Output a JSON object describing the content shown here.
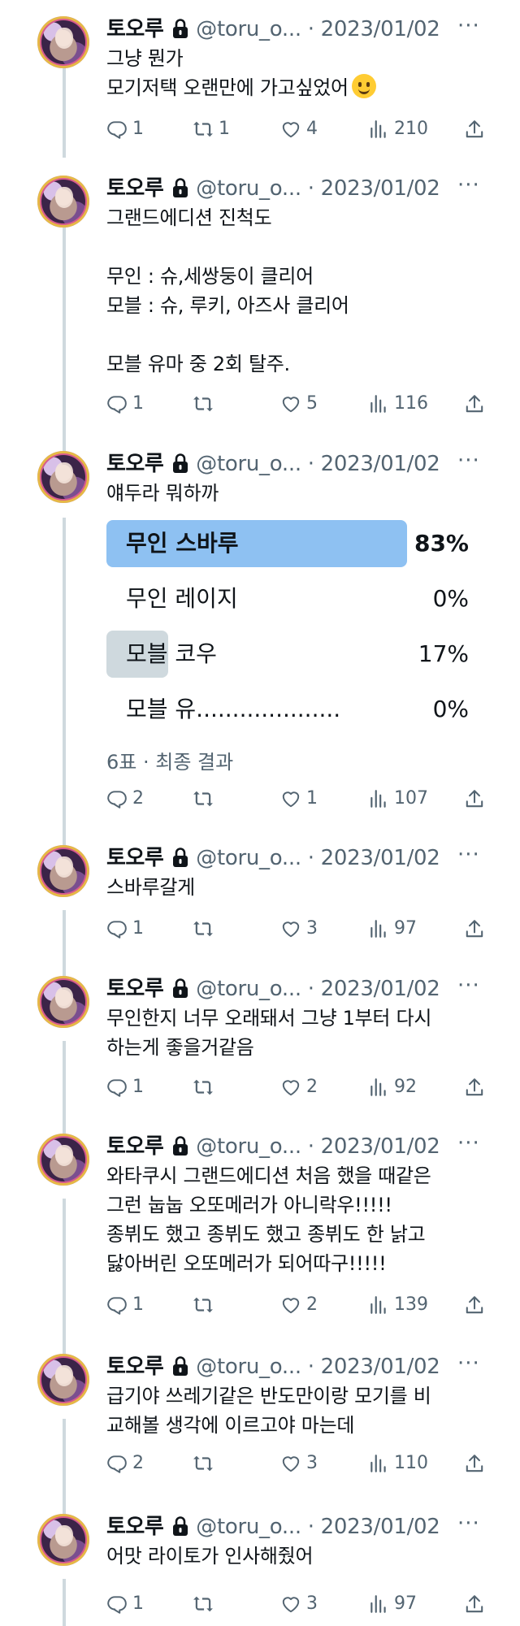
{
  "tweets": [
    {
      "name": "토오루",
      "handle": "@toru_o... · 2023/01/02",
      "text": "그냥 뭔가\n모기저택 오랜만에 가고싶었어",
      "emoji": "slightly-smiling-face",
      "replies": "1",
      "retweets": "1",
      "likes": "4",
      "views": "210"
    },
    {
      "name": "토오루",
      "handle": "@toru_o... · 2023/01/02",
      "text": "그랜드에디션 진척도\n\n무인 : 슈,세쌍둥이 클리어\n모블 : 슈, 루키, 아즈사 클리어\n\n모블 유마 중 2회 탈주.",
      "replies": "1",
      "retweets": "",
      "likes": "5",
      "views": "116"
    },
    {
      "name": "토오루",
      "handle": "@toru_o... · 2023/01/02",
      "text": "얘두라 뭐하까",
      "poll": {
        "options": [
          {
            "label": "무인 스바루",
            "pct": "83%",
            "value": 83,
            "winner": true
          },
          {
            "label": "무인 레이지",
            "pct": "0%",
            "value": 0,
            "winner": false
          },
          {
            "label": "모블 코우",
            "pct": "17%",
            "value": 17,
            "winner": false
          },
          {
            "label": "모블 유....................",
            "pct": "0%",
            "value": 0,
            "winner": false
          }
        ],
        "meta": "6표 · 최종 결과"
      },
      "replies": "2",
      "retweets": "",
      "likes": "1",
      "views": "107"
    },
    {
      "name": "토오루",
      "handle": "@toru_o... · 2023/01/02",
      "text": "스바루갈게",
      "replies": "1",
      "retweets": "",
      "likes": "3",
      "views": "97"
    },
    {
      "name": "토오루",
      "handle": "@toru_o... · 2023/01/02",
      "text": "무인한지 너무 오래돼서 그냥 1부터 다시\n하는게 좋을거같음",
      "replies": "1",
      "retweets": "",
      "likes": "2",
      "views": "92"
    },
    {
      "name": "토오루",
      "handle": "@toru_o... · 2023/01/02",
      "text": "와타쿠시 그랜드에디션 처음 했을 때같은\n그런 눕눕 오또메러가 아니락우!!!!!\n종뷔도 했고 종뷔도 했고 종뷔도 한 낡고\n닳아버린 오또메러가 되어따구!!!!!",
      "replies": "1",
      "retweets": "",
      "likes": "2",
      "views": "139"
    },
    {
      "name": "토오루",
      "handle": "@toru_o... · 2023/01/02",
      "text": "급기야 쓰레기같은 반도만이랑 모기를 비\n교해볼 생각에 이르고야 마는데",
      "replies": "2",
      "retweets": "",
      "likes": "3",
      "views": "110"
    },
    {
      "name": "토오루",
      "handle": "@toru_o... · 2023/01/02",
      "text": "어맛 라이토가 인사해줬어",
      "replies": "1",
      "retweets": "",
      "likes": "3",
      "views": "97"
    }
  ],
  "more_label": "···",
  "colors": {
    "poll_winner": "#8ec1f2",
    "poll_other": "#cfd9de",
    "muted": "#536471",
    "thread_line": "#cfd9de"
  }
}
